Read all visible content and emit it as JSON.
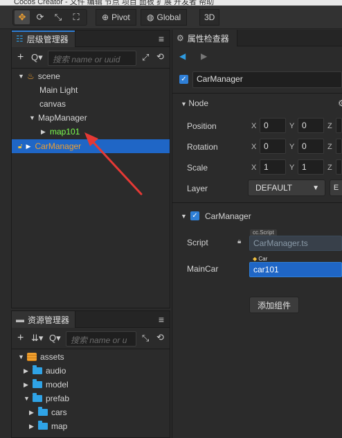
{
  "window": {
    "title": "Cocos Creator - 文件  编辑  节点  项目  面板  扩展  开发者  帮助"
  },
  "toolbar": {
    "pivot_label": "Pivot",
    "global_label": "Global",
    "mode_3d_label": "3D"
  },
  "hierarchy": {
    "tab_label": "层级管理器",
    "search_placeholder": "搜索 name or uuid",
    "nodes": [
      {
        "label": "scene"
      },
      {
        "label": "Main Light"
      },
      {
        "label": "canvas"
      },
      {
        "label": "MapManager"
      },
      {
        "label": "map101"
      },
      {
        "label": "CarManager"
      }
    ]
  },
  "assets": {
    "tab_label": "资源管理器",
    "search_placeholder": "搜索 name or u",
    "items": [
      {
        "label": "assets"
      },
      {
        "label": "audio"
      },
      {
        "label": "model"
      },
      {
        "label": "prefab"
      },
      {
        "label": "cars"
      },
      {
        "label": "map"
      }
    ]
  },
  "inspector": {
    "tab_label": "属性检查器",
    "node_name": "CarManager",
    "node_section_label": "Node",
    "position_label": "Position",
    "rotation_label": "Rotation",
    "scale_label": "Scale",
    "layer_label": "Layer",
    "layer_value": "DEFAULT",
    "axis_x": "X",
    "axis_y": "Y",
    "axis_z": "Z",
    "position": {
      "x": "0",
      "y": "0"
    },
    "rotation": {
      "x": "0",
      "y": "0"
    },
    "scale": {
      "x": "1",
      "y": "1"
    },
    "component_label": "CarManager",
    "script_label": "Script",
    "script_tag": "cc.Script",
    "script_value": "CarManager.ts",
    "maincar_label": "MainCar",
    "maincar_tag": "Car",
    "maincar_value": "car101",
    "add_component_label": "添加组件"
  },
  "colors": {
    "accent_blue": "#1f66c6",
    "highlight_green": "#7cff4f",
    "selected_text_orange": "#f0a030",
    "annotation_red": "#e53935"
  }
}
